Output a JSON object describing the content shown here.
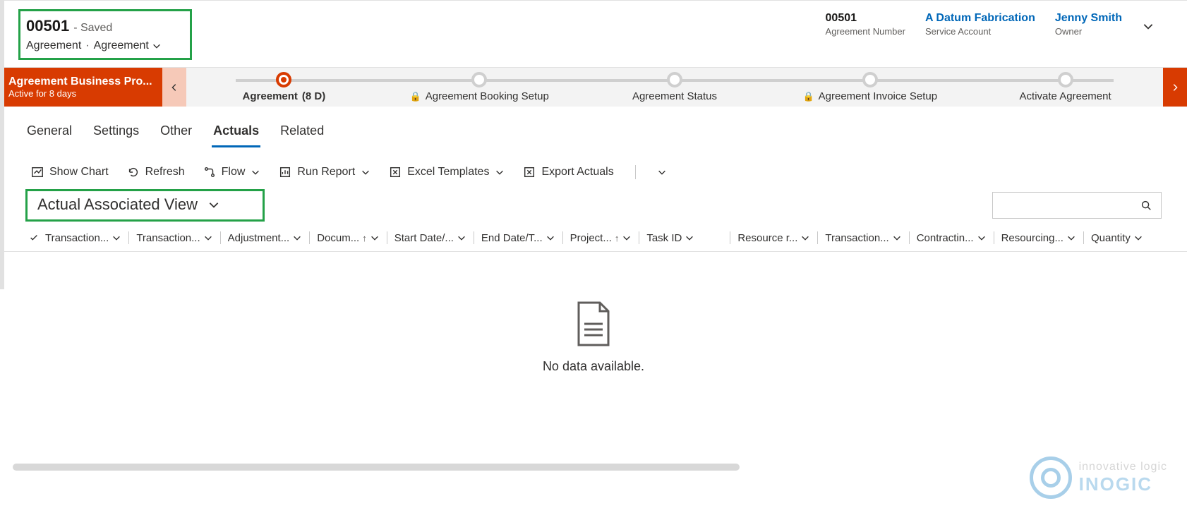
{
  "header": {
    "record_id": "00501",
    "saved_suffix": "- Saved",
    "entity": "Agreement",
    "form_selector": "Agreement",
    "fields": [
      {
        "value": "00501",
        "label": "Agreement Number",
        "link": false
      },
      {
        "value": "A Datum Fabrication",
        "label": "Service Account",
        "link": true
      },
      {
        "value": "Jenny Smith",
        "label": "Owner",
        "link": true
      }
    ]
  },
  "bpf": {
    "title": "Agreement Business Pro...",
    "subtitle": "Active for 8 days",
    "stages": [
      {
        "label": "Agreement",
        "suffix": "(8 D)",
        "active": true,
        "locked": false
      },
      {
        "label": "Agreement Booking Setup",
        "locked": true
      },
      {
        "label": "Agreement Status",
        "locked": false
      },
      {
        "label": "Agreement Invoice Setup",
        "locked": true
      },
      {
        "label": "Activate Agreement",
        "locked": false
      }
    ]
  },
  "tabs": [
    {
      "label": "General",
      "active": false
    },
    {
      "label": "Settings",
      "active": false
    },
    {
      "label": "Other",
      "active": false
    },
    {
      "label": "Actuals",
      "active": true
    },
    {
      "label": "Related",
      "active": false
    }
  ],
  "toolbar": {
    "show_chart": "Show Chart",
    "refresh": "Refresh",
    "flow": "Flow",
    "run_report": "Run Report",
    "excel_templates": "Excel Templates",
    "export": "Export Actuals"
  },
  "view": {
    "name": "Actual Associated View",
    "search_placeholder": ""
  },
  "columns": [
    {
      "label": "Transaction...",
      "sort": null
    },
    {
      "label": "Transaction...",
      "sort": null
    },
    {
      "label": "Adjustment...",
      "sort": null
    },
    {
      "label": "Docum...",
      "sort": "asc"
    },
    {
      "label": "Start Date/...",
      "sort": null
    },
    {
      "label": "End Date/T...",
      "sort": null
    },
    {
      "label": "Project...",
      "sort": "asc"
    },
    {
      "label": "Task ID",
      "sort": null,
      "gap_after": true
    },
    {
      "label": "Resource r...",
      "sort": null
    },
    {
      "label": "Transaction...",
      "sort": null
    },
    {
      "label": "Contractin...",
      "sort": null
    },
    {
      "label": "Resourcing...",
      "sort": null
    },
    {
      "label": "Quantity",
      "sort": null
    }
  ],
  "empty_text": "No data available.",
  "watermark": {
    "line1": "innovative logic",
    "line2": "inogic"
  }
}
